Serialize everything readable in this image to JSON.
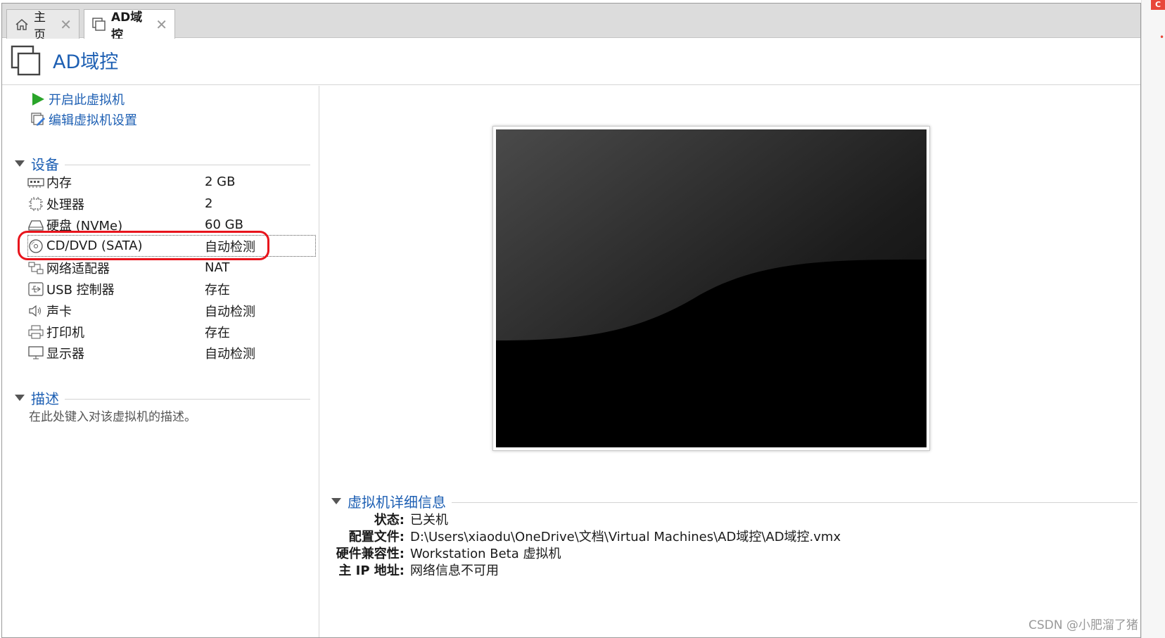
{
  "tabs": [
    {
      "label": "主页",
      "icon": "home-icon",
      "active": false
    },
    {
      "label": "AD域控",
      "icon": "vm-icon",
      "active": true
    }
  ],
  "vm": {
    "title": "AD域控"
  },
  "actions": {
    "power_on": "开启此虚拟机",
    "edit_settings": "编辑虚拟机设置"
  },
  "devices_section": {
    "label": "设备",
    "items": [
      {
        "name": "内存",
        "value": "2 GB",
        "icon": "memory-icon"
      },
      {
        "name": "处理器",
        "value": "2",
        "icon": "cpu-icon"
      },
      {
        "name": "硬盘 (NVMe)",
        "value": "60 GB",
        "icon": "hard-disk-icon"
      },
      {
        "name": "CD/DVD (SATA)",
        "value": "自动检测",
        "icon": "cd-dvd-icon"
      },
      {
        "name": "网络适配器",
        "value": "NAT",
        "icon": "network-adapter-icon"
      },
      {
        "name": "USB 控制器",
        "value": "存在",
        "icon": "usb-icon"
      },
      {
        "name": "声卡",
        "value": "自动检测",
        "icon": "speaker-icon"
      },
      {
        "name": "打印机",
        "value": "存在",
        "icon": "printer-icon"
      },
      {
        "name": "显示器",
        "value": "自动检测",
        "icon": "monitor-icon"
      }
    ]
  },
  "description_section": {
    "label": "描述",
    "placeholder": "在此处键入对该虚拟机的描述。"
  },
  "details_section": {
    "label": "虚拟机详细信息",
    "rows": [
      {
        "key": "状态:",
        "value": "已关机"
      },
      {
        "key": "配置文件:",
        "value": "D:\\Users\\xiaodu\\OneDrive\\文档\\Virtual Machines\\AD域控\\AD域控.vmx"
      },
      {
        "key": "硬件兼容性:",
        "value": "Workstation Beta 虚拟机"
      },
      {
        "key": "主 IP 地址:",
        "value": "网络信息不可用"
      }
    ]
  },
  "colors": {
    "accent": "#1d5fb3",
    "annotation": "#e8141c",
    "play_green": "#2aa52a"
  },
  "watermark": "CSDN @小肥溜了猪"
}
